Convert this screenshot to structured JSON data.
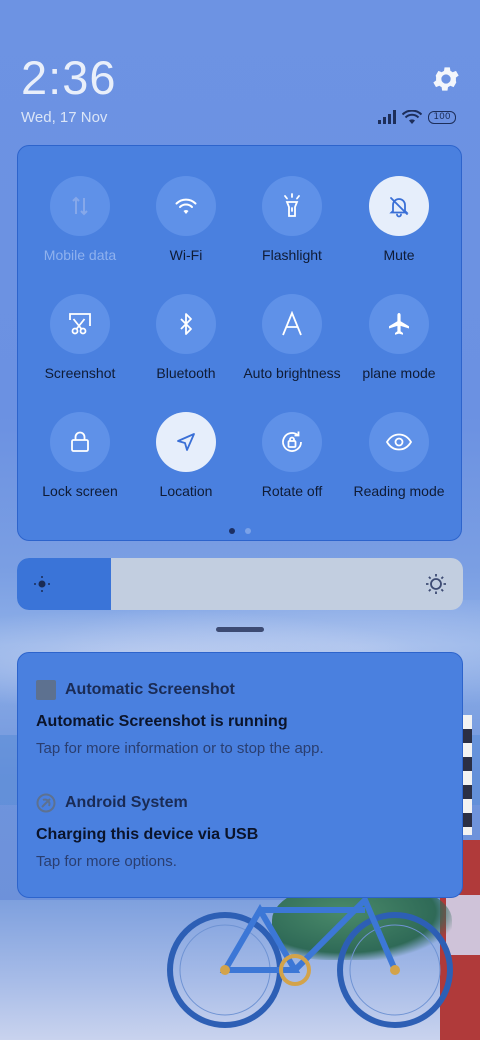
{
  "status": {
    "time": "2:36",
    "date": "Wed, 17 Nov",
    "battery": "100"
  },
  "quick_settings": {
    "tiles": [
      {
        "label": "Mobile data",
        "icon": "mobile-data-icon",
        "active": false,
        "disabled": true
      },
      {
        "label": "Wi-Fi",
        "icon": "wifi-icon",
        "active": false
      },
      {
        "label": "Flashlight",
        "icon": "flashlight-icon",
        "active": false
      },
      {
        "label": "Mute",
        "icon": "mute-bell-icon",
        "active": true
      },
      {
        "label": "Screenshot",
        "icon": "screenshot-icon",
        "active": false
      },
      {
        "label": "Bluetooth",
        "icon": "bluetooth-icon",
        "active": false
      },
      {
        "label": "Auto brightness",
        "icon": "auto-brightness-icon",
        "active": false
      },
      {
        "label": "plane mode",
        "icon": "airplane-icon",
        "active": false
      },
      {
        "label": "Lock screen",
        "icon": "lock-icon",
        "active": false
      },
      {
        "label": "Location",
        "icon": "location-arrow-icon",
        "active": true
      },
      {
        "label": "Rotate off",
        "icon": "rotate-lock-icon",
        "active": false
      },
      {
        "label": "Reading mode",
        "icon": "eye-icon",
        "active": false
      }
    ],
    "page_count": 2,
    "current_page": 1
  },
  "brightness": {
    "level": 0.21
  },
  "notifications": [
    {
      "app": "Automatic Screenshot",
      "title": "Automatic Screenshot is running",
      "text": "Tap for more information or to stop the app."
    },
    {
      "app": "Android System",
      "title": "Charging this device via USB",
      "text": "Tap for more options."
    }
  ],
  "colors": {
    "panel": "#4a80df",
    "tile": "#5f91e8",
    "tile_active": "#e6eefb",
    "brightness_fill": "#3a74d8"
  }
}
